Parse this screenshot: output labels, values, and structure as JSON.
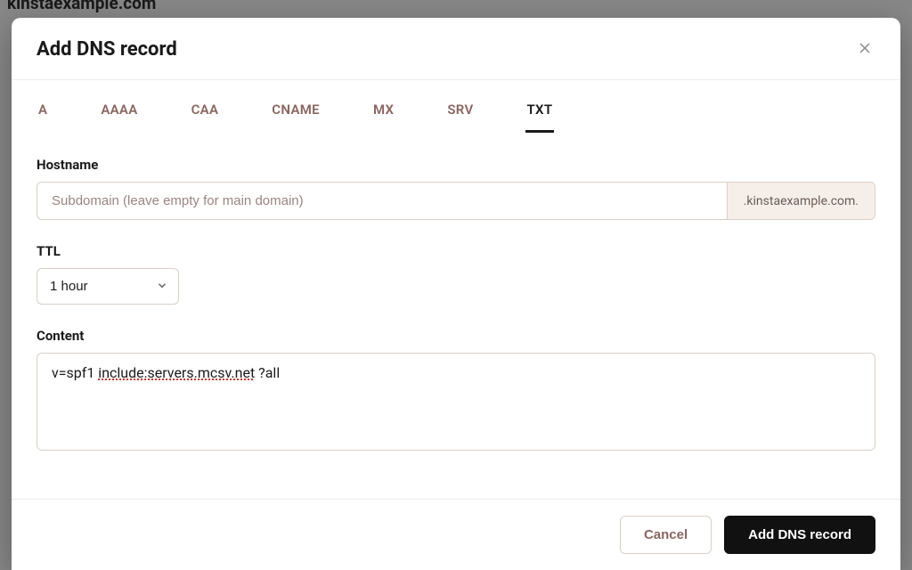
{
  "backdrop": {
    "domain_heading": "kinstaexample.com"
  },
  "modal": {
    "title": "Add DNS record",
    "tabs": [
      {
        "label": "A",
        "active": false
      },
      {
        "label": "AAAA",
        "active": false
      },
      {
        "label": "CAA",
        "active": false
      },
      {
        "label": "CNAME",
        "active": false
      },
      {
        "label": "MX",
        "active": false
      },
      {
        "label": "SRV",
        "active": false
      },
      {
        "label": "TXT",
        "active": true
      }
    ],
    "hostname": {
      "label": "Hostname",
      "placeholder": "Subdomain (leave empty for main domain)",
      "value": "",
      "suffix": ".kinstaexample.com."
    },
    "ttl": {
      "label": "TTL",
      "value": "1 hour"
    },
    "content": {
      "label": "Content",
      "value": "v=spf1 include:servers.mcsv.net ?all",
      "segments": [
        {
          "text": "v=spf1 ",
          "spell": false
        },
        {
          "text": "include:servers.mcsv.net",
          "spell": true
        },
        {
          "text": " ?all",
          "spell": false
        }
      ]
    },
    "footer": {
      "cancel": "Cancel",
      "submit": "Add DNS record"
    }
  }
}
